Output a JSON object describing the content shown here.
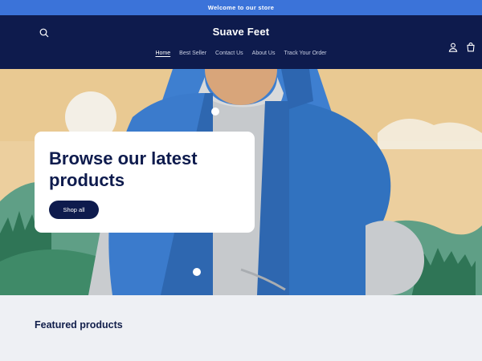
{
  "announcement": {
    "text": "Welcome to our store"
  },
  "header": {
    "brand": "Suave Feet",
    "icons": {
      "search": "search-icon",
      "account": "user-icon",
      "cart": "cart-icon"
    },
    "nav": [
      {
        "label": "Home",
        "active": true
      },
      {
        "label": "Best Seller",
        "active": false
      },
      {
        "label": "Contact Us",
        "active": false
      },
      {
        "label": "About Us",
        "active": false
      },
      {
        "label": "Track Your Order",
        "active": false
      }
    ]
  },
  "hero": {
    "headline": "Browse our latest products",
    "cta_label": "Shop all"
  },
  "featured": {
    "title": "Featured products"
  },
  "colors": {
    "announcement_bg": "#3b73d9",
    "header_bg": "#0e1b4d",
    "page_bg": "#eef0f4",
    "button_bg": "#0e1b4d"
  }
}
